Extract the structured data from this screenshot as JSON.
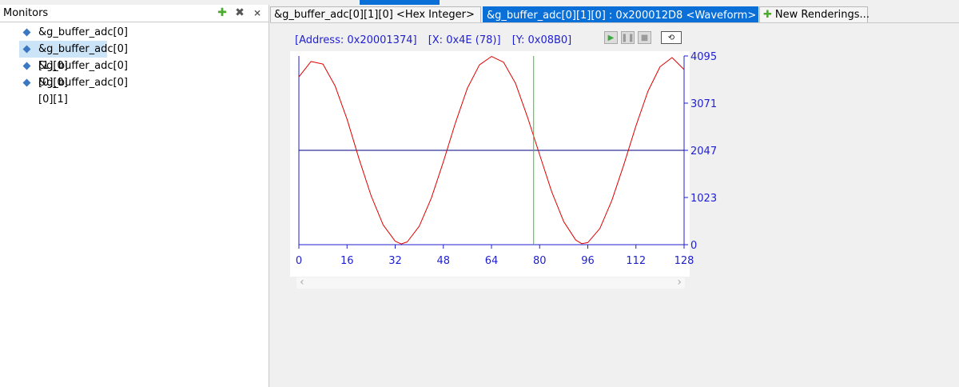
{
  "monitors": {
    "title": "Monitors",
    "icons": [
      "add-monitor-icon",
      "remove-monitor-icon",
      "remove-all-monitors-icon"
    ],
    "items": [
      {
        "label": "&g_buffer_adc[0][1][1]",
        "selected": false
      },
      {
        "label": "&g_buffer_adc[0][1][0]",
        "selected": true
      },
      {
        "label": "&g_buffer_adc[0][0][0]",
        "selected": false
      },
      {
        "label": "&g_buffer_adc[0][0][1]",
        "selected": false
      }
    ]
  },
  "tabs": [
    {
      "label": "&g_buffer_adc[0][1][0] <Hex Integer>",
      "active": false
    },
    {
      "label": "&g_buffer_adc[0][1][0] : 0x200012D8 <Waveform>",
      "active": true,
      "close": "×"
    },
    {
      "label": "New Renderings...",
      "active": false,
      "icon": "add-icon",
      "plus": "✚"
    }
  ],
  "waveform": {
    "address": "[Address: 0x20001374]",
    "x_readout": "[X: 0x4E (78)]",
    "y_readout": "[Y: 0x08B0]",
    "cursor_x": 78,
    "controls": [
      "play-icon",
      "pause-icon",
      "stop-icon",
      "loop-icon"
    ]
  },
  "chart_data": {
    "type": "line",
    "title": "",
    "xlabel": "",
    "ylabel": "",
    "xlim": [
      0,
      128
    ],
    "ylim": [
      0,
      4095
    ],
    "x_ticks": [
      "0",
      "16",
      "32",
      "48",
      "64",
      "80",
      "96",
      "112",
      "128"
    ],
    "y_ticks": [
      "4095",
      "3071.25",
      "2047.5",
      "1023.75",
      "0"
    ],
    "y_tick_values": [
      4095,
      3071.25,
      2047.5,
      1023.75,
      0
    ],
    "midline": 2047.5,
    "series": [
      {
        "color": "#e00000",
        "x": [
          0,
          4,
          8,
          12,
          16,
          20,
          24,
          28,
          32,
          34,
          36,
          40,
          44,
          48,
          52,
          56,
          60,
          64,
          68,
          72,
          76,
          80,
          84,
          88,
          92,
          94,
          96,
          100,
          104,
          108,
          112,
          116,
          120,
          124,
          128
        ],
        "y": [
          3640,
          3975,
          3920,
          3450,
          2720,
          1860,
          1060,
          430,
          75,
          15,
          60,
          400,
          1010,
          1800,
          2640,
          3400,
          3900,
          4085,
          3960,
          3500,
          2760,
          1950,
          1150,
          500,
          100,
          20,
          45,
          350,
          960,
          1740,
          2580,
          3330,
          3860,
          4060,
          3800
        ]
      }
    ],
    "cursor_color": "#22cc22",
    "axis_color": "#1f1fd2"
  }
}
